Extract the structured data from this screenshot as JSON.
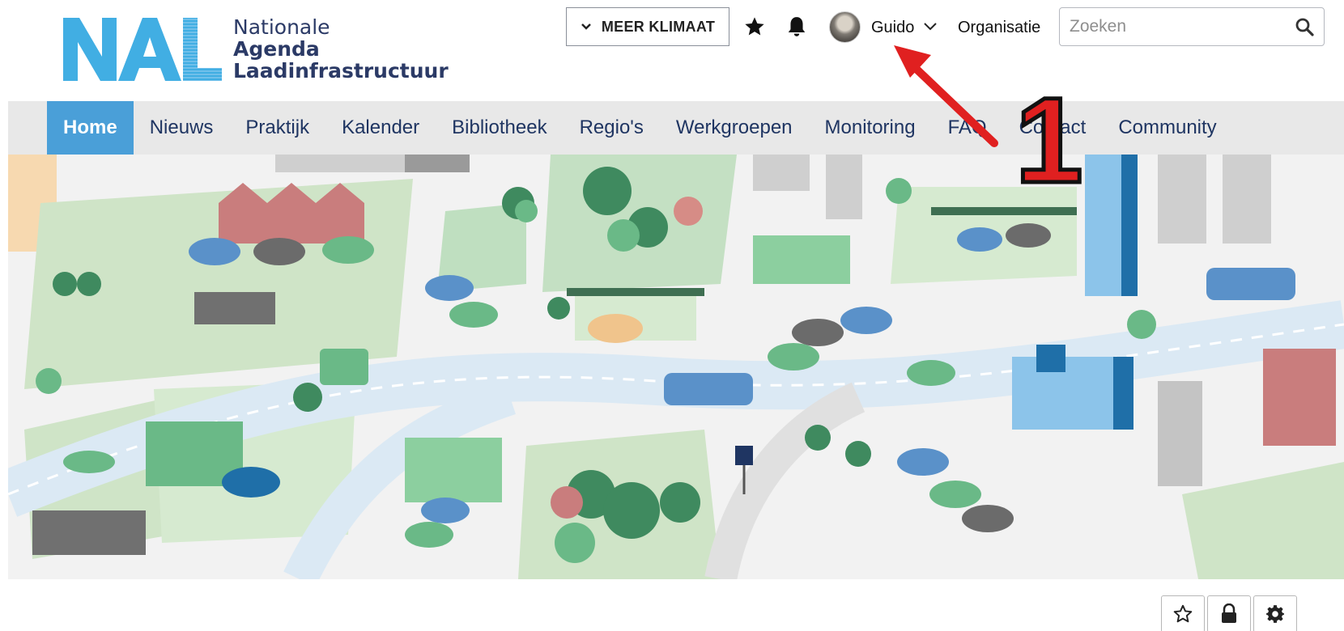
{
  "logo": {
    "mark": "NAL",
    "lines": [
      "Nationale",
      "Agenda",
      "Laadinfrastructuur"
    ]
  },
  "header": {
    "meer_label": "MEER KLIMAAT",
    "favorites_icon": "star-icon",
    "notifications_icon": "bell-icon",
    "user_name": "Guido",
    "organisatie_label": "Organisatie",
    "search_placeholder": "Zoeken"
  },
  "nav": {
    "items": [
      "Home",
      "Nieuws",
      "Praktijk",
      "Kalender",
      "Bibliotheek",
      "Regio's",
      "Werkgroepen",
      "Monitoring",
      "FAQ",
      "Contact",
      "Community"
    ],
    "active": "Home"
  },
  "annotation": {
    "number": "1",
    "color": "#e02020"
  },
  "toolbar": {
    "icons": [
      "star-outline-icon",
      "lock-icon",
      "gear-icon"
    ]
  },
  "colors": {
    "accent": "#4a9fd8",
    "logo_blue": "#41aee3",
    "logo_text": "#2b3a66"
  }
}
